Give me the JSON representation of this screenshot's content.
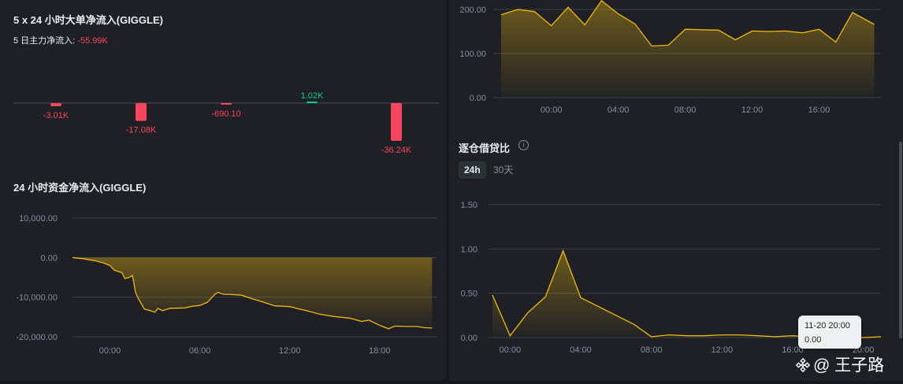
{
  "colors": {
    "accent": "#f0b90b",
    "negative": "#f6465d",
    "positive": "#0ecb81",
    "panel": "#1e2026",
    "grid": "#2b3139",
    "axis_text": "#848e9c"
  },
  "left": {
    "big_order_title": "5 x 24 小时大单净流入(GIGGLE)",
    "five_day_label": "5 日主力净流入:",
    "five_day_value": "-55.99K",
    "net_flow_title": "24 小时资金净流入(GIGGLE)"
  },
  "right": {
    "margin_title": "逐仓借贷比",
    "info_icon": "info-icon",
    "tabs": [
      {
        "label": "24h",
        "active": true
      },
      {
        "label": "30天",
        "active": false
      }
    ],
    "tooltip": {
      "time": "11-20 20:00",
      "value": "0.00"
    }
  },
  "watermark": {
    "text": "@ 王子路",
    "icon": "binance-logo-icon"
  },
  "chart_data": [
    {
      "id": "big-order",
      "type": "bar",
      "categories": [
        "1",
        "2",
        "3",
        "4",
        "5"
      ],
      "values": [
        -3.01,
        -17.08,
        -0.6901,
        1.02,
        -36.24
      ],
      "value_labels": [
        "-3.01K",
        "-17.08K",
        "-690.10",
        "1.02K",
        "-36.24K"
      ],
      "title": "5 x 24 小时大单净流入(GIGGLE)",
      "ylim": [
        -40,
        5
      ],
      "grid": false
    },
    {
      "id": "net-flow",
      "type": "area",
      "title": "24 小时资金净流入(GIGGLE)",
      "x_ticks": [
        "00:00",
        "06:00",
        "12:00",
        "18:00"
      ],
      "y_ticks": [
        "10,000.00",
        "0.00",
        "-10,000.00",
        "-20,000.00"
      ],
      "ylim": [
        -20000,
        10000
      ],
      "xlim_hours": [
        -2.5,
        21.8
      ],
      "grid": true,
      "points": [
        [
          -2.5,
          0
        ],
        [
          -1.8,
          -300
        ],
        [
          -1.0,
          -800
        ],
        [
          -0.4,
          -1400
        ],
        [
          0.0,
          -2000
        ],
        [
          0.3,
          -3200
        ],
        [
          0.8,
          -3800
        ],
        [
          1.0,
          -5300
        ],
        [
          1.3,
          -5000
        ],
        [
          1.5,
          -4500
        ],
        [
          1.6,
          -6500
        ],
        [
          1.7,
          -8800
        ],
        [
          1.9,
          -10400
        ],
        [
          2.3,
          -13000
        ],
        [
          2.6,
          -13300
        ],
        [
          3.0,
          -13800
        ],
        [
          3.2,
          -12800
        ],
        [
          3.5,
          -13400
        ],
        [
          4.0,
          -12800
        ],
        [
          5.0,
          -12700
        ],
        [
          5.5,
          -12300
        ],
        [
          6.0,
          -12100
        ],
        [
          6.5,
          -11300
        ],
        [
          7.0,
          -9300
        ],
        [
          7.2,
          -8800
        ],
        [
          7.6,
          -9300
        ],
        [
          8.0,
          -9300
        ],
        [
          8.8,
          -9500
        ],
        [
          9.5,
          -10400
        ],
        [
          10.2,
          -11200
        ],
        [
          11.0,
          -12200
        ],
        [
          12.0,
          -12400
        ],
        [
          13.0,
          -13300
        ],
        [
          14.0,
          -14300
        ],
        [
          15.0,
          -14900
        ],
        [
          16.0,
          -15300
        ],
        [
          16.8,
          -16100
        ],
        [
          17.3,
          -15800
        ],
        [
          18.0,
          -17100
        ],
        [
          18.6,
          -18000
        ],
        [
          19.0,
          -17300
        ],
        [
          19.8,
          -17400
        ],
        [
          20.5,
          -17400
        ],
        [
          21.0,
          -17700
        ],
        [
          21.5,
          -17800
        ]
      ]
    },
    {
      "id": "top-right",
      "type": "area",
      "x_ticks": [
        "00:00",
        "04:00",
        "08:00",
        "12:00",
        "16:00"
      ],
      "y_ticks": [
        "200.00",
        "100.00",
        "0.00"
      ],
      "ylim": [
        0,
        200
      ],
      "xlim_hours": [
        -3,
        19.7
      ],
      "grid": true,
      "points": [
        [
          -3,
          188
        ],
        [
          -2,
          200
        ],
        [
          -1,
          195
        ],
        [
          0,
          163
        ],
        [
          1,
          205
        ],
        [
          2,
          165
        ],
        [
          3,
          220
        ],
        [
          4,
          190
        ],
        [
          5,
          167
        ],
        [
          6,
          117
        ],
        [
          7,
          119
        ],
        [
          8,
          155
        ],
        [
          9,
          154
        ],
        [
          10,
          153
        ],
        [
          11,
          131
        ],
        [
          12,
          151
        ],
        [
          13,
          150
        ],
        [
          14,
          151
        ],
        [
          15,
          147
        ],
        [
          16,
          155
        ],
        [
          17,
          126
        ],
        [
          18,
          193
        ],
        [
          19.3,
          166
        ]
      ]
    },
    {
      "id": "margin-ratio",
      "type": "area",
      "title": "逐仓借贷比",
      "x_ticks": [
        "00:00",
        "04:00",
        "08:00",
        "12:00",
        "16:00",
        "20:00"
      ],
      "y_ticks": [
        "1.50",
        "1.00",
        "0.50",
        "0.00"
      ],
      "ylim": [
        0,
        1.5
      ],
      "xlim_hours": [
        -1,
        21
      ],
      "grid": true,
      "points": [
        [
          -1,
          0.48
        ],
        [
          0,
          0.02
        ],
        [
          1,
          0.28
        ],
        [
          2,
          0.46
        ],
        [
          3,
          0.98
        ],
        [
          4,
          0.45
        ],
        [
          5,
          0.35
        ],
        [
          6,
          0.25
        ],
        [
          7,
          0.15
        ],
        [
          8,
          0.01
        ],
        [
          9,
          0.03
        ],
        [
          10,
          0.02
        ],
        [
          11,
          0.02
        ],
        [
          12,
          0.03
        ],
        [
          13,
          0.03
        ],
        [
          14,
          0.02
        ],
        [
          15,
          0.01
        ],
        [
          16,
          0.02
        ],
        [
          17,
          0.01
        ],
        [
          18,
          0.03
        ],
        [
          19,
          0.01
        ],
        [
          20,
          0.0
        ],
        [
          21,
          0.01
        ]
      ]
    }
  ]
}
